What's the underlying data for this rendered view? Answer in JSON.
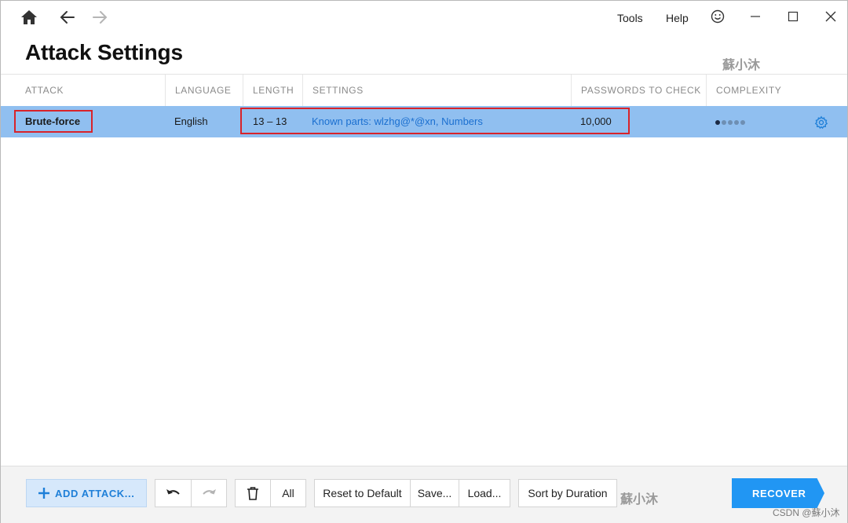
{
  "menu": {
    "tools": "Tools",
    "help": "Help"
  },
  "page": {
    "title": "Attack Settings"
  },
  "watermark": {
    "top": "蘇小沐",
    "bottom": "蘇小沐",
    "credit": "CSDN @蘇小沐"
  },
  "table": {
    "columns": [
      "ATTACK",
      "LANGUAGE",
      "LENGTH",
      "SETTINGS",
      "PASSWORDS TO CHECK",
      "COMPLEXITY"
    ],
    "rows": [
      {
        "attack": "Brute-force",
        "language": "English",
        "length": "13 – 13",
        "settings": "Known parts: wlzhg@*@xn, Numbers",
        "passwords": "10,000",
        "complexity": 1,
        "complexity_max": 5
      }
    ]
  },
  "bottom": {
    "add_attack": "ADD ATTACK...",
    "all": "All",
    "reset": "Reset to Default",
    "save": "Save...",
    "load": "Load...",
    "sort": "Sort by Duration",
    "recover": "RECOVER"
  },
  "colors": {
    "row_selected": "#90bff0",
    "accent": "#2196f3",
    "highlight_box": "#d8232a",
    "settings_text": "#1a6fd0"
  },
  "icons": [
    "home-icon",
    "back-arrow-icon",
    "forward-arrow-icon",
    "smiley-icon",
    "minimize-icon",
    "maximize-icon",
    "close-icon",
    "gear-icon",
    "plus-icon",
    "undo-icon",
    "redo-icon",
    "trash-icon"
  ]
}
